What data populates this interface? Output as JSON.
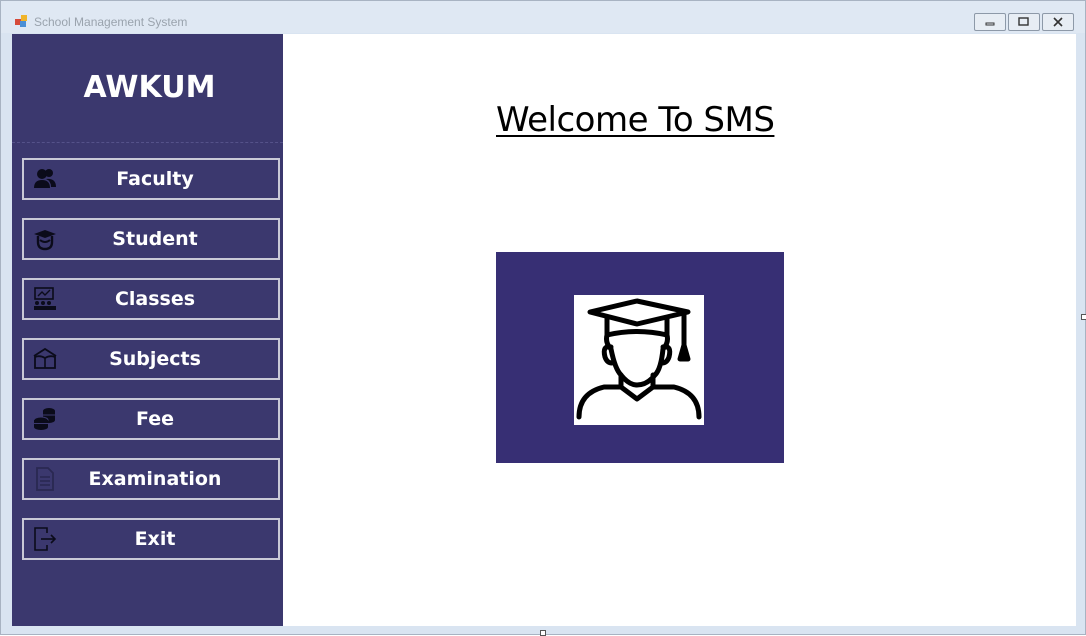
{
  "window": {
    "title": "School Management System",
    "controls": [
      "minimize",
      "maximize",
      "close"
    ]
  },
  "sidebar": {
    "brand": "AWKUM",
    "items": [
      {
        "label": "Faculty",
        "icon": "faculty-icon"
      },
      {
        "label": "Student",
        "icon": "student-icon"
      },
      {
        "label": "Classes",
        "icon": "classes-icon"
      },
      {
        "label": "Subjects",
        "icon": "subjects-icon"
      },
      {
        "label": "Fee",
        "icon": "fee-icon"
      },
      {
        "label": "Examination",
        "icon": "examination-icon"
      },
      {
        "label": "Exit",
        "icon": "exit-icon"
      }
    ]
  },
  "main": {
    "heading": "Welcome To SMS",
    "logo_icon": "graduate-icon"
  },
  "colors": {
    "sidebar_bg": "#3b386e",
    "logo_bg": "#372f74",
    "button_border": "#c9c9d6",
    "text_light": "#ffffff"
  }
}
